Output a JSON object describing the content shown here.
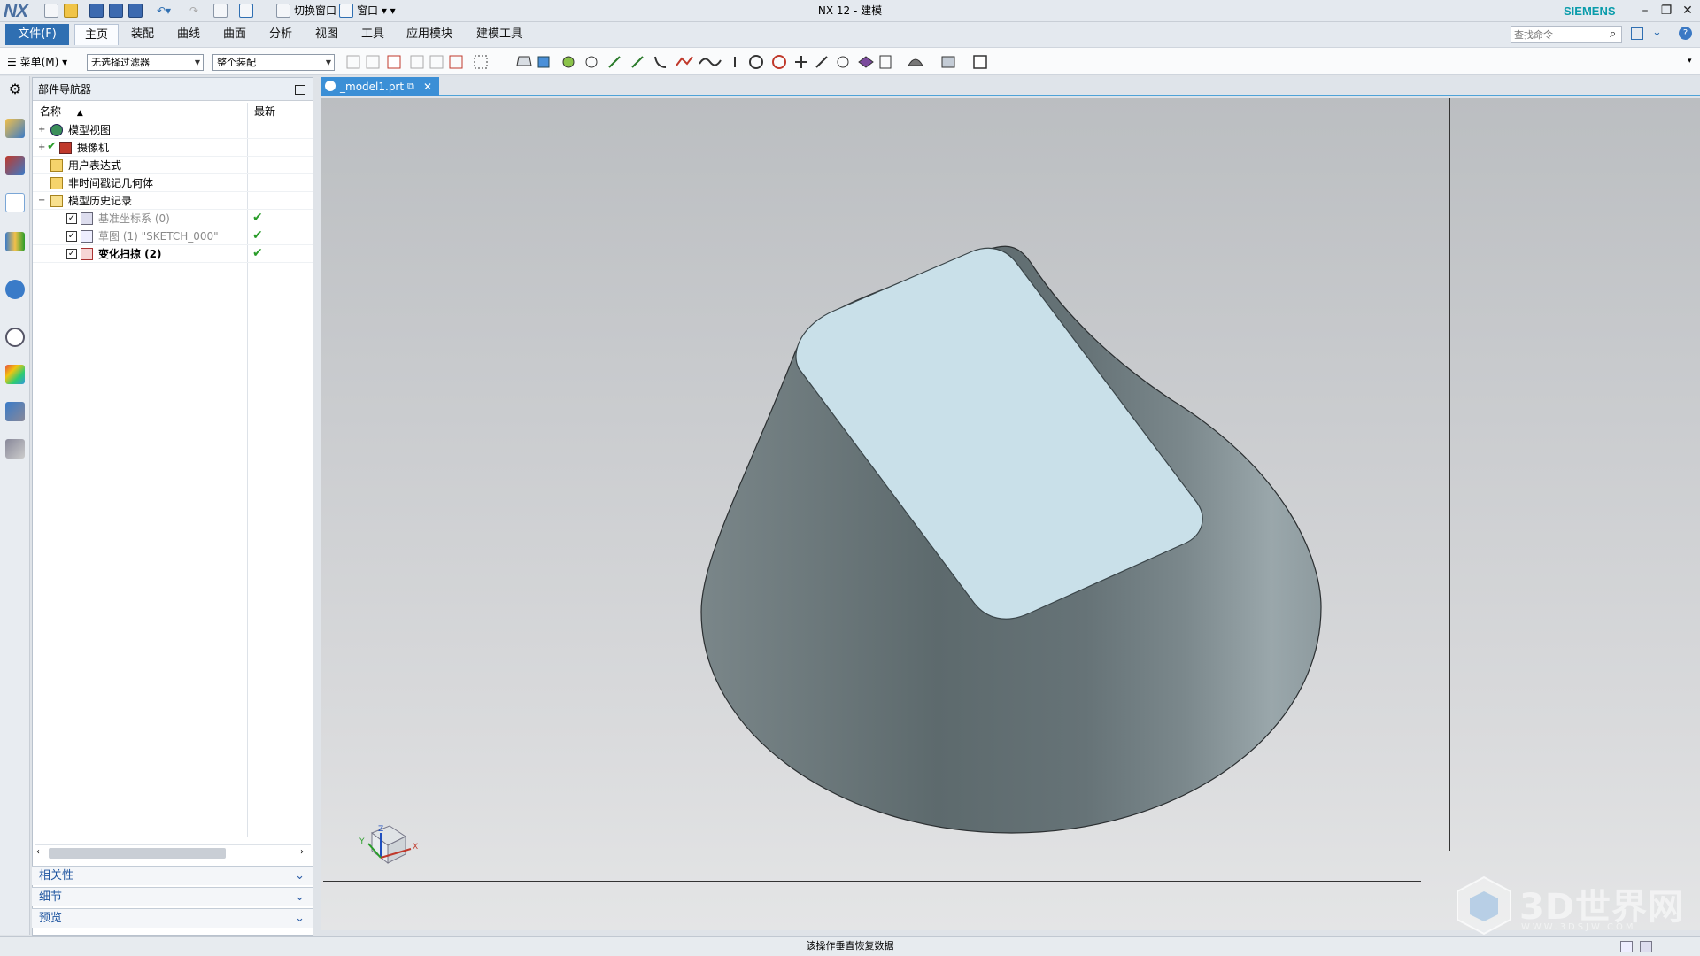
{
  "app": {
    "logo": "NX",
    "title": "NX 12 - 建模",
    "brand": "SIEMENS",
    "switch_window": "切换窗口",
    "window_menu": "窗口"
  },
  "menu": {
    "file": "文件(F)",
    "tabs": [
      "主页",
      "装配",
      "曲线",
      "曲面",
      "分析",
      "视图",
      "工具",
      "应用模块",
      "建模工具"
    ],
    "active_tab": "主页",
    "search_placeholder": "查找命令"
  },
  "toolbar": {
    "menu_button": "菜单(M)",
    "filter": "无选择过滤器",
    "scope": "整个装配"
  },
  "navigator": {
    "title": "部件导航器",
    "col_name": "名称",
    "col_latest": "最新",
    "rows": [
      {
        "label": "模型视图",
        "icon": "model-views-icon"
      },
      {
        "label": "摄像机",
        "icon": "camera-icon"
      },
      {
        "label": "用户表达式",
        "icon": "folder-icon"
      },
      {
        "label": "非时间戳记几何体",
        "icon": "folder-icon"
      },
      {
        "label": "模型历史记录",
        "icon": "folder-open-icon"
      },
      {
        "label": "基准坐标系 (0)",
        "icon": "datum-csys-icon",
        "latest": "✔"
      },
      {
        "label": "草图 (1) \"SKETCH_000\"",
        "icon": "sketch-icon",
        "latest": "✔"
      },
      {
        "label": "变化扫掠 (2)",
        "icon": "variational-sweep-icon",
        "latest": "✔"
      }
    ],
    "panels": [
      "相关性",
      "细节",
      "预览"
    ]
  },
  "document_tab": "_model1.prt",
  "status": {
    "message": "该操作垂直恢复数据"
  },
  "watermark": {
    "text": "3D世界网",
    "sub": "WWW.3DSJW.COM"
  },
  "colors": {
    "accent": "#2f6fb2",
    "brand": "#0a9cab",
    "check": "#2a9d2a"
  }
}
